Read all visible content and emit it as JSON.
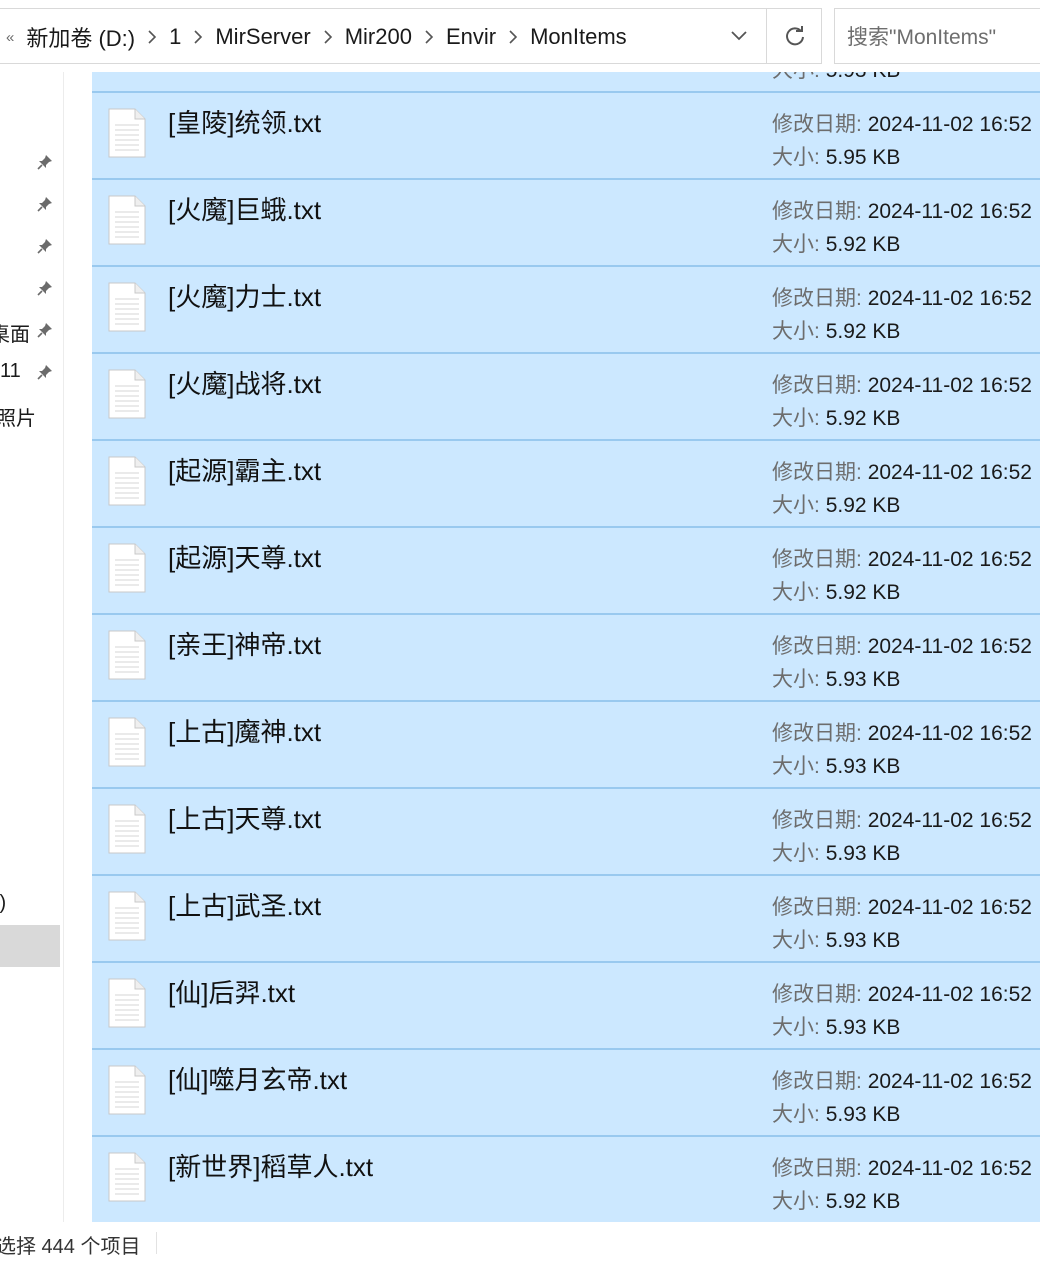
{
  "breadcrumb": {
    "lead": "«",
    "items": [
      "新加卷 (D:)",
      "1",
      "MirServer",
      "Mir200",
      "Envir",
      "MonItems"
    ]
  },
  "search": {
    "placeholder": "搜索\"MonItems\""
  },
  "nav": {
    "partial_labels": [
      "桌面",
      "11",
      "照片",
      ":)"
    ]
  },
  "files": {
    "date_label": "修改日期:",
    "size_label": "大小:",
    "partial_top_size": "5.93 KB",
    "items": [
      {
        "name": "[皇陵]统领.txt",
        "date": "2024-11-02 16:52",
        "size": "5.95 KB"
      },
      {
        "name": "[火魔]巨蛾.txt",
        "date": "2024-11-02 16:52",
        "size": "5.92 KB"
      },
      {
        "name": "[火魔]力士.txt",
        "date": "2024-11-02 16:52",
        "size": "5.92 KB"
      },
      {
        "name": "[火魔]战将.txt",
        "date": "2024-11-02 16:52",
        "size": "5.92 KB"
      },
      {
        "name": "[起源]霸主.txt",
        "date": "2024-11-02 16:52",
        "size": "5.92 KB"
      },
      {
        "name": "[起源]天尊.txt",
        "date": "2024-11-02 16:52",
        "size": "5.92 KB"
      },
      {
        "name": "[亲王]神帝.txt",
        "date": "2024-11-02 16:52",
        "size": "5.93 KB"
      },
      {
        "name": "[上古]魔神.txt",
        "date": "2024-11-02 16:52",
        "size": "5.93 KB"
      },
      {
        "name": "[上古]天尊.txt",
        "date": "2024-11-02 16:52",
        "size": "5.93 KB"
      },
      {
        "name": "[上古]武圣.txt",
        "date": "2024-11-02 16:52",
        "size": "5.93 KB"
      },
      {
        "name": "[仙]后羿.txt",
        "date": "2024-11-02 16:52",
        "size": "5.93 KB"
      },
      {
        "name": "[仙]噬月玄帝.txt",
        "date": "2024-11-02 16:52",
        "size": "5.93 KB"
      },
      {
        "name": "[新世界]稻草人.txt",
        "date": "2024-11-02 16:52",
        "size": "5.92 KB"
      }
    ]
  },
  "status": {
    "text": "选择 444 个项目"
  },
  "icons": {
    "pin": "pin-icon",
    "chevron": "chevron-right-icon",
    "dropdown": "chevron-down-icon",
    "refresh": "refresh-icon",
    "file": "text-file-icon"
  },
  "colors": {
    "selection_bg": "#cce8ff",
    "selection_border": "#99c9ef"
  }
}
